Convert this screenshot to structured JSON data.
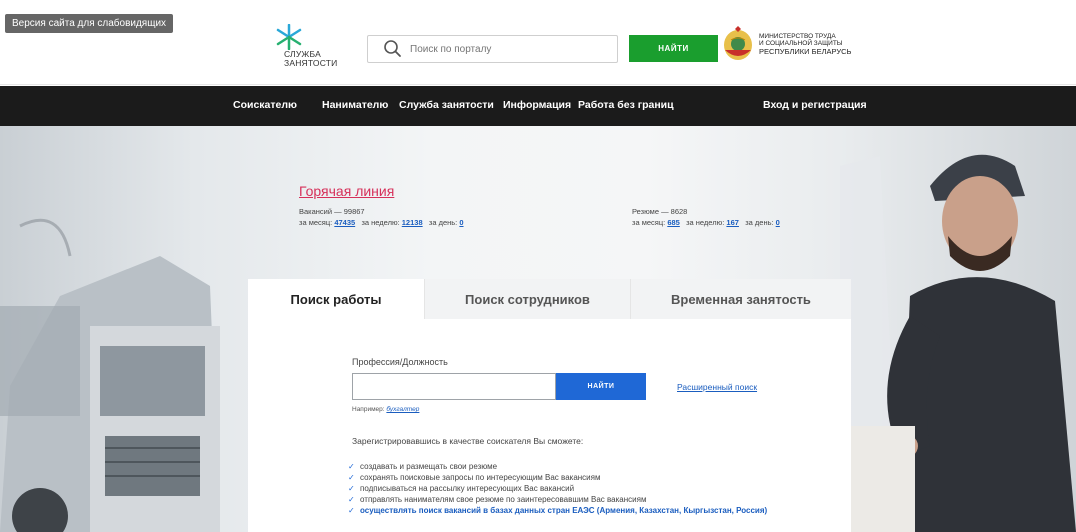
{
  "header": {
    "low_vision_label": "Версия сайта для слабовидящих",
    "logo_line1": "СЛУЖБА",
    "logo_line2": "ЗАНЯТОСТИ",
    "search_placeholder": "Поиск по порталу",
    "search_button": "НАЙТИ",
    "ministry_line1": "МИНИСТЕРСТВО ТРУДА",
    "ministry_line2": "И СОЦИАЛЬНОЙ ЗАЩИТЫ",
    "ministry_line3": "РЕСПУБЛИКИ БЕЛАРУСЬ"
  },
  "nav": {
    "items": [
      "Соискателю",
      "Нанимателю",
      "Служба занятости",
      "Информация",
      "Работа без границ"
    ],
    "login": "Вход и регистрация"
  },
  "hotline": "Горячая линия",
  "vacancies": {
    "title": "Вакансий — 99867",
    "month_label": "за месяц:",
    "month": "47435",
    "week_label": "за неделю:",
    "week": "12138",
    "day_label": "за день:",
    "day": "0"
  },
  "resumes": {
    "title": "Резюме — 8628",
    "month_label": "за месяц:",
    "month": "685",
    "week_label": "за неделю:",
    "week": "167",
    "day_label": "за день:",
    "day": "0"
  },
  "tabs": [
    "Поиск работы",
    "Поиск сотрудников",
    "Временная занятость"
  ],
  "form": {
    "profession_label": "Профессия/Должность",
    "profession_value": "",
    "find_button": "НАЙТИ",
    "advanced_search": "Расширенный поиск",
    "example_label": "Например:",
    "example_value": "бухгалтер",
    "register_text": "Зарегистрировавшись в качестве соискателя Вы сможете:",
    "benefits": [
      "создавать и размещать свои резюме",
      "сохранять поисковые запросы по интересующим Вас вакансиям",
      "подписываться на рассылку интересующих Вас вакансий",
      "отправлять нанимателям свое резюме по заинтересовавшим Вас вакансиям",
      "осуществлять поиск вакансий в базах данных стран ЕАЭС (Армения, Казахстан, Кыргызстан, Россия)"
    ]
  },
  "colors": {
    "green": "#1a9e2e",
    "blue": "#1f68d6",
    "nav_bg": "#1b1b1b",
    "hotline": "#d6305a"
  }
}
